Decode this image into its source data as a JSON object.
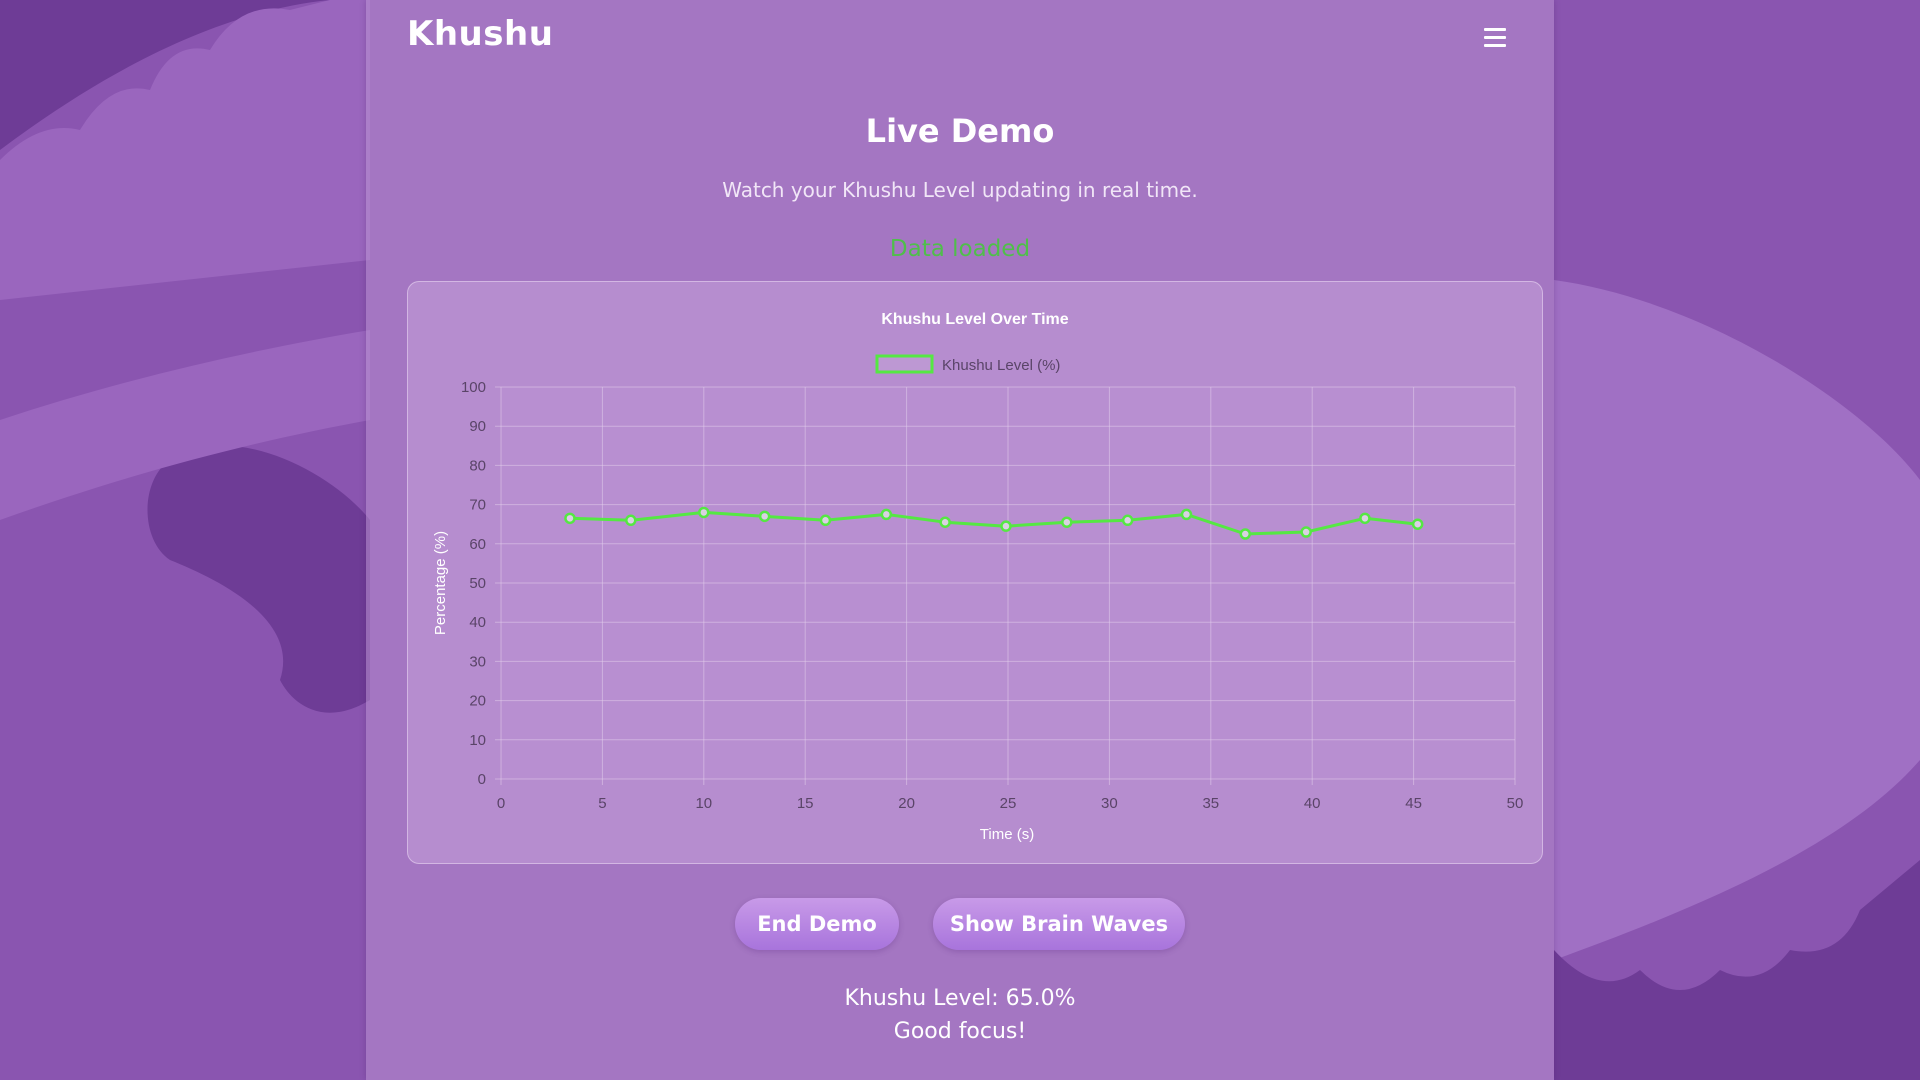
{
  "app": {
    "name": "Khushu"
  },
  "header": {
    "menu_icon": "hamburger-menu-icon"
  },
  "main": {
    "title": "Live Demo",
    "subtitle": "Watch your Khushu Level updating in real time.",
    "status": "Data loaded"
  },
  "chart_data": {
    "type": "line",
    "title": "Khushu Level Over Time",
    "xlabel": "Time (s)",
    "ylabel": "Percentage (%)",
    "xlim": [
      0,
      50
    ],
    "ylim": [
      0,
      100
    ],
    "x_ticks": [
      0,
      5,
      10,
      15,
      20,
      25,
      30,
      35,
      40,
      45,
      50
    ],
    "y_ticks": [
      0,
      10,
      20,
      30,
      40,
      50,
      60,
      70,
      80,
      90,
      100
    ],
    "grid": true,
    "legend": "top-center",
    "series": [
      {
        "name": "Khushu Level (%)",
        "color": "#55e843",
        "x": [
          3.4,
          6.4,
          10.0,
          13.0,
          16.0,
          19.0,
          21.9,
          24.9,
          27.9,
          30.9,
          33.8,
          36.7,
          39.7,
          42.6,
          45.2
        ],
        "values": [
          66.5,
          66.0,
          68.0,
          67.0,
          66.0,
          67.5,
          65.5,
          64.5,
          65.5,
          66.0,
          67.5,
          62.5,
          63.0,
          66.5,
          65.0
        ]
      }
    ]
  },
  "buttons": {
    "end_demo": "End Demo",
    "show_waves": "Show Brain Waves"
  },
  "result": {
    "level_text": "Khushu Level: 65.0%",
    "message": "Good focus!"
  }
}
